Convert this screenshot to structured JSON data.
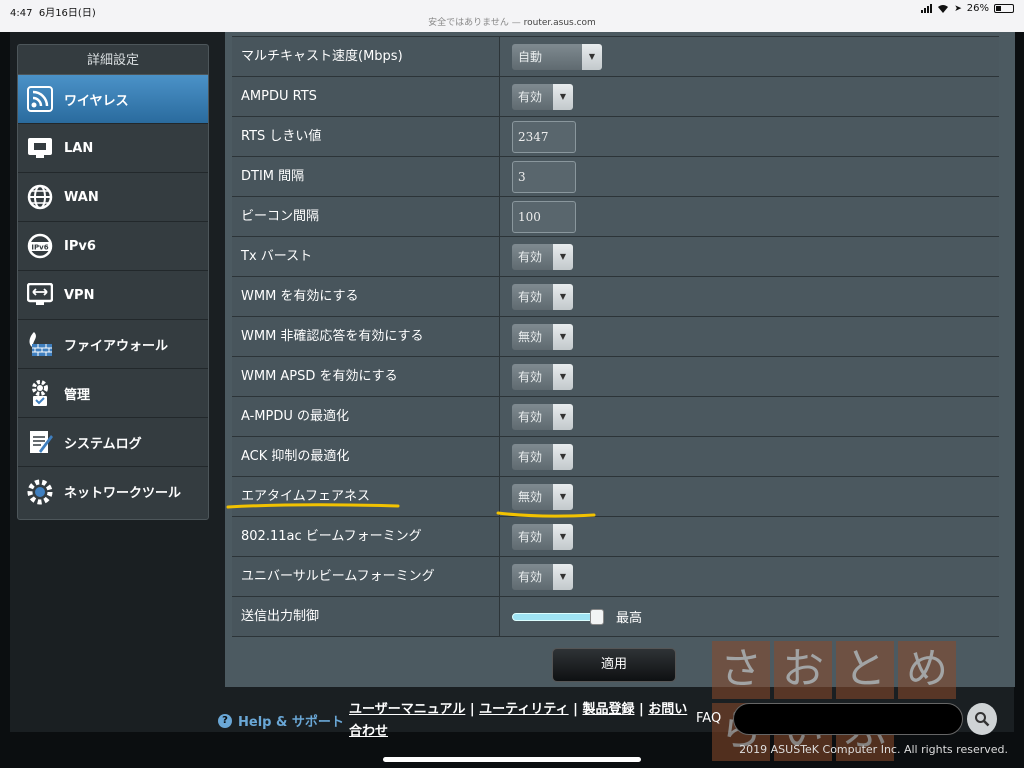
{
  "status_bar": {
    "time": "4:47",
    "date": "6月16日(日)",
    "security_text": "安全ではありません —",
    "domain": "router.asus.com",
    "battery": "26%"
  },
  "sidebar": {
    "title": "詳細設定",
    "items": [
      {
        "label": "ワイヤレス",
        "icon": "wifi-icon",
        "active": true
      },
      {
        "label": "LAN",
        "icon": "lan-icon"
      },
      {
        "label": "WAN",
        "icon": "globe-icon"
      },
      {
        "label": "IPv6",
        "icon": "ipv6-icon"
      },
      {
        "label": "VPN",
        "icon": "vpn-icon"
      },
      {
        "label": "ファイアウォール",
        "icon": "firewall-icon"
      },
      {
        "label": "管理",
        "icon": "admin-gear-icon"
      },
      {
        "label": "システムログ",
        "icon": "log-icon"
      },
      {
        "label": "ネットワークツール",
        "icon": "tools-icon"
      }
    ]
  },
  "settings": {
    "rows": [
      {
        "label": "マルチキャスト速度(Mbps)",
        "type": "select",
        "value": "自動"
      },
      {
        "label": "AMPDU RTS",
        "type": "select",
        "value": "有効"
      },
      {
        "label": "RTS しきい値",
        "type": "text",
        "value": "2347"
      },
      {
        "label": "DTIM 間隔",
        "type": "text",
        "value": "3"
      },
      {
        "label": "ビーコン間隔",
        "type": "text",
        "value": "100"
      },
      {
        "label": "Tx バースト",
        "type": "select",
        "value": "有効"
      },
      {
        "label": "WMM を有効にする",
        "type": "select",
        "value": "有効"
      },
      {
        "label": "WMM 非確認応答を有効にする",
        "type": "select",
        "value": "無効"
      },
      {
        "label": "WMM APSD を有効にする",
        "type": "select",
        "value": "有効"
      },
      {
        "label": "A-MPDU の最適化",
        "type": "select",
        "value": "有効"
      },
      {
        "label": "ACK 抑制の最適化",
        "type": "select",
        "value": "有効"
      },
      {
        "label": "エアタイムフェアネス",
        "type": "select",
        "value": "無効"
      },
      {
        "label": "802.11ac ビームフォーミング",
        "type": "select",
        "value": "有効"
      },
      {
        "label": "ユニバーサルビームフォーミング",
        "type": "select",
        "value": "有効"
      },
      {
        "label": "送信出力制御",
        "type": "slider",
        "value": "最高",
        "level": 1.0
      }
    ]
  },
  "apply_label": "適用",
  "footer": {
    "help_label": "Help & サポート",
    "manual_link": "ユーザーマニュアル",
    "utility_link": "ユーティリティ",
    "register_link": "製品登録",
    "contact_link": "お問い合わせ",
    "faq_label": "FAQ",
    "copyright": "2019 ASUSTeK Computer Inc. All rights reserved."
  },
  "watermark": [
    "さ",
    "お",
    "と",
    "め",
    "ら",
    "い",
    "ふ",
    ""
  ],
  "colors": {
    "active_tab": "#3f86bd",
    "highlight": "#f2c200",
    "help_link": "#6aa7d6"
  }
}
